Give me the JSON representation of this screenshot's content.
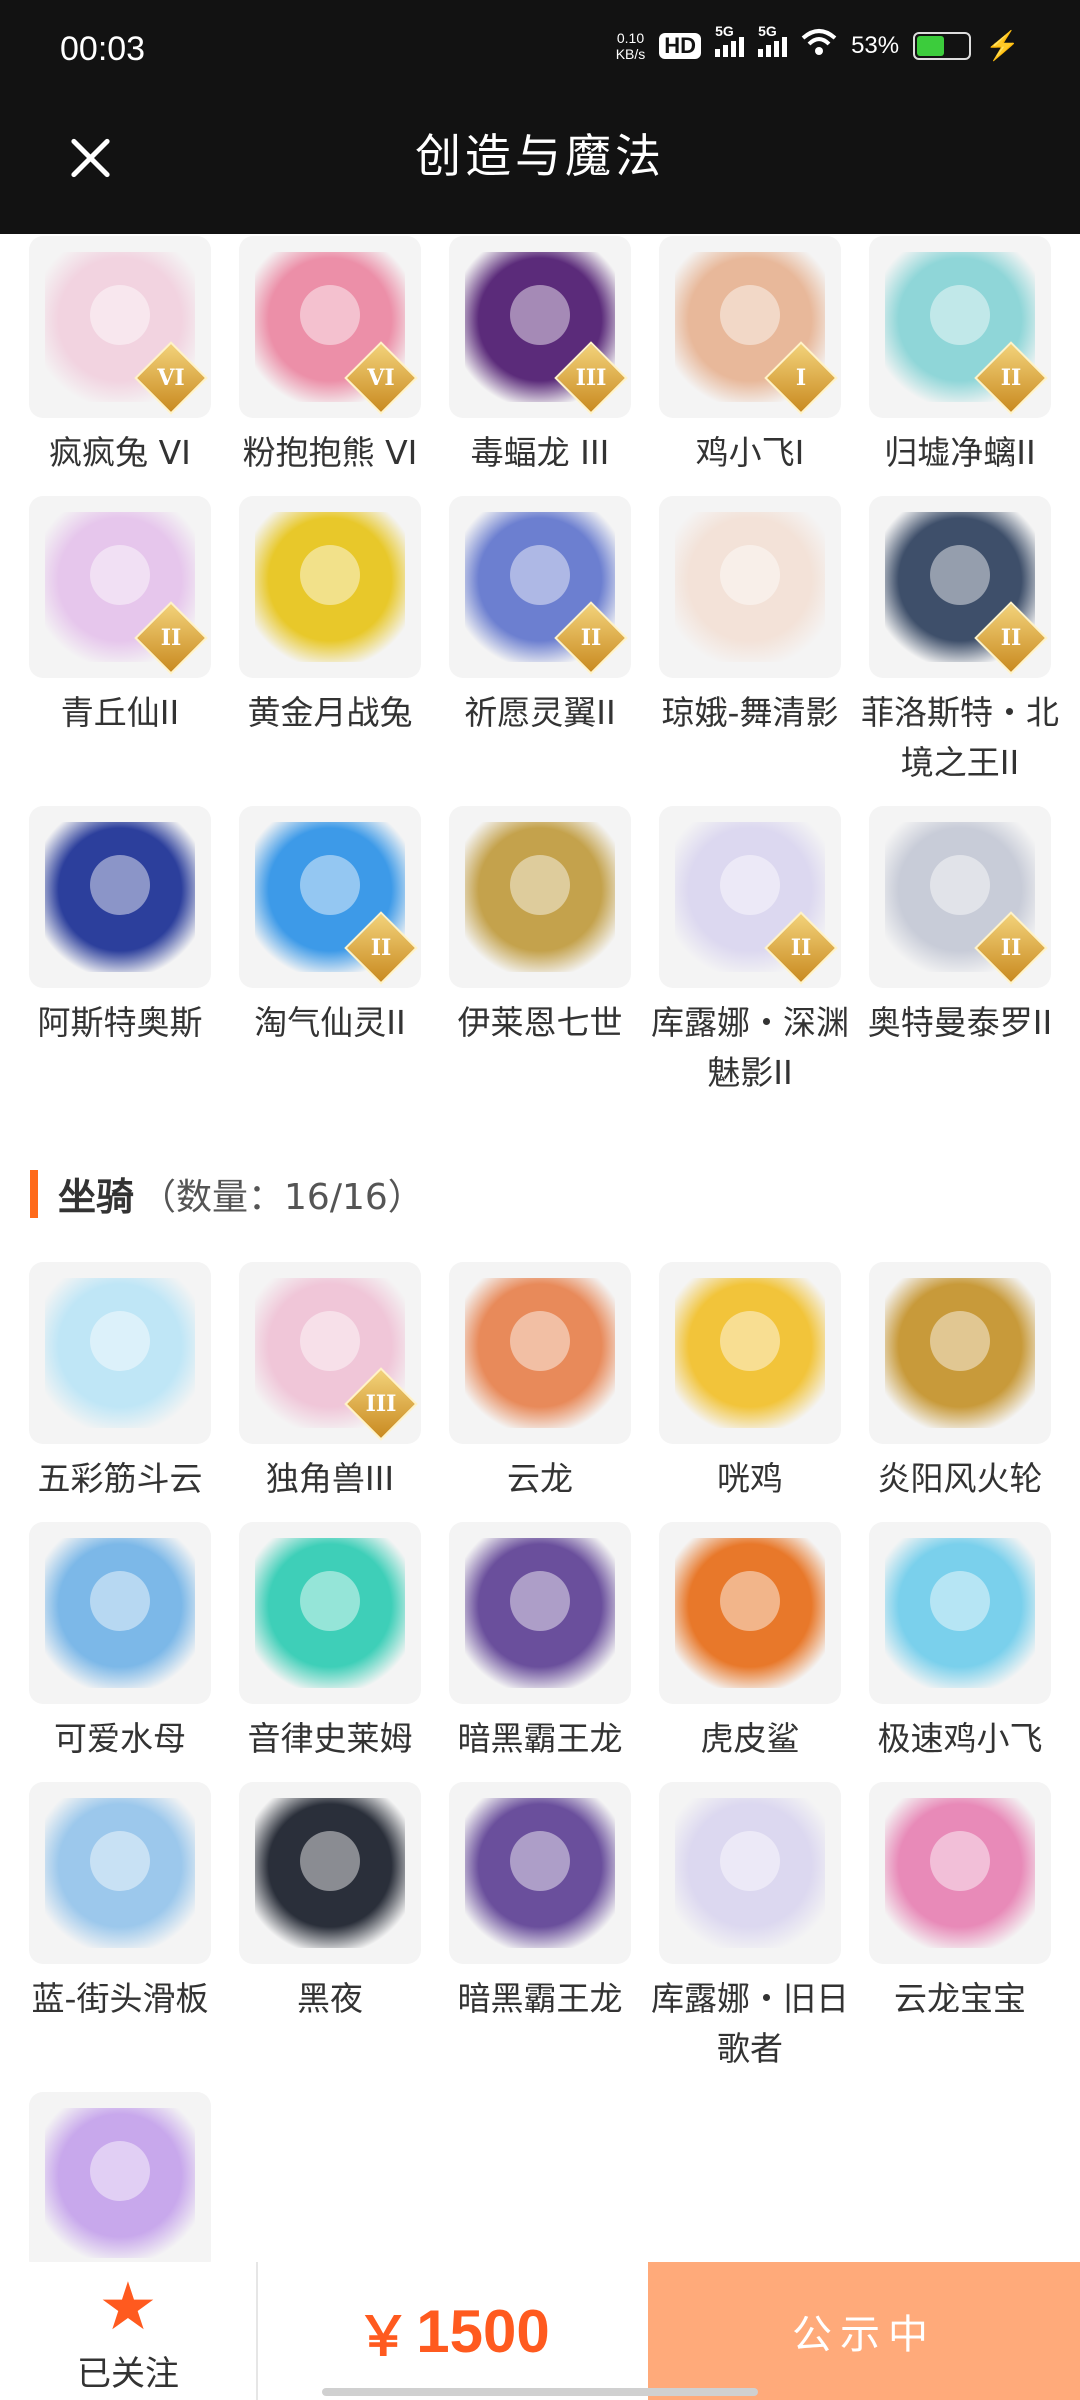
{
  "status_bar": {
    "time": "00:03",
    "net_speed_value": "0.10",
    "net_speed_unit": "KB/s",
    "hd_label": "HD",
    "sim1_label": "5G",
    "sim2_label": "5G",
    "battery": "53%",
    "battery_level": 0.53
  },
  "header": {
    "title": "创造与魔法"
  },
  "colors": {
    "accent": "#ff6a1a",
    "price": "#ff5a1f",
    "action_bg": "#ffaa7a",
    "header_bg": "#121212"
  },
  "pets": [
    {
      "label": "疯疯兔 VI",
      "badge": "VI",
      "color": "#f2d3e0"
    },
    {
      "label": "粉抱抱熊 VI",
      "badge": "VI",
      "color": "#ec8fa8"
    },
    {
      "label": "毒蝠龙 III",
      "badge": "III",
      "color": "#5b2b7a"
    },
    {
      "label": "鸡小飞I",
      "badge": "I",
      "color": "#e8b89a"
    },
    {
      "label": "归墟净螭II",
      "badge": "II",
      "color": "#8fd6d8"
    },
    {
      "label": "青丘仙II",
      "badge": "II",
      "color": "#e6c6ec"
    },
    {
      "label": "黄金月战兔",
      "badge": "",
      "color": "#e8c82a"
    },
    {
      "label": "祈愿灵翼II",
      "badge": "II",
      "color": "#6c7fd0"
    },
    {
      "label": "琼娥-舞清影",
      "badge": "",
      "color": "#f3e2d8"
    },
    {
      "label": "菲洛斯特・北境之王II",
      "badge": "II",
      "color": "#3e4f6a"
    },
    {
      "label": "阿斯特奥斯",
      "badge": "",
      "color": "#2c3f9c"
    },
    {
      "label": "淘气仙灵II",
      "badge": "II",
      "color": "#3d9ae8"
    },
    {
      "label": "伊莱恩七世",
      "badge": "",
      "color": "#c4a24c"
    },
    {
      "label": "库露娜・深渊魅影II",
      "badge": "II",
      "color": "#dcd8f0"
    },
    {
      "label": "奥特曼泰罗II",
      "badge": "II",
      "color": "#c8ccd8"
    }
  ],
  "mount_section": {
    "title": "坐骑",
    "count": "（数量：16/16）"
  },
  "mounts": [
    {
      "label": "五彩筋斗云",
      "badge": "",
      "color": "#bfe6f6"
    },
    {
      "label": "独角兽III",
      "badge": "III",
      "color": "#f0c6d8"
    },
    {
      "label": "云龙",
      "badge": "",
      "color": "#e88a5a"
    },
    {
      "label": "咣鸡",
      "badge": "",
      "color": "#f2c43a"
    },
    {
      "label": "炎阳风火轮",
      "badge": "",
      "color": "#c89a3a"
    },
    {
      "label": "可爱水母",
      "badge": "",
      "color": "#7cb8e8"
    },
    {
      "label": "音律史莱姆",
      "badge": "",
      "color": "#3ecfb8"
    },
    {
      "label": "暗黑霸王龙",
      "badge": "",
      "color": "#6a4f9c"
    },
    {
      "label": "虎皮鲨",
      "badge": "",
      "color": "#e8782a"
    },
    {
      "label": "极速鸡小飞",
      "badge": "",
      "color": "#7ad0ec"
    },
    {
      "label": "蓝-街头滑板",
      "badge": "",
      "color": "#9cc8ec"
    },
    {
      "label": "黑夜",
      "badge": "",
      "color": "#2a2f3a"
    },
    {
      "label": "暗黑霸王龙",
      "badge": "",
      "color": "#6a4f9c"
    },
    {
      "label": "库露娜・旧日歌者",
      "badge": "",
      "color": "#dcd8f0"
    },
    {
      "label": "云龙宝宝",
      "badge": "",
      "color": "#e88ab8"
    },
    {
      "label": "",
      "badge": "",
      "color": "#c8a8ec"
    }
  ],
  "bottom_bar": {
    "follow_icon": "star-icon",
    "follow_label": "已关注",
    "currency": "￥",
    "price": "1500",
    "action_label": "公示中"
  }
}
